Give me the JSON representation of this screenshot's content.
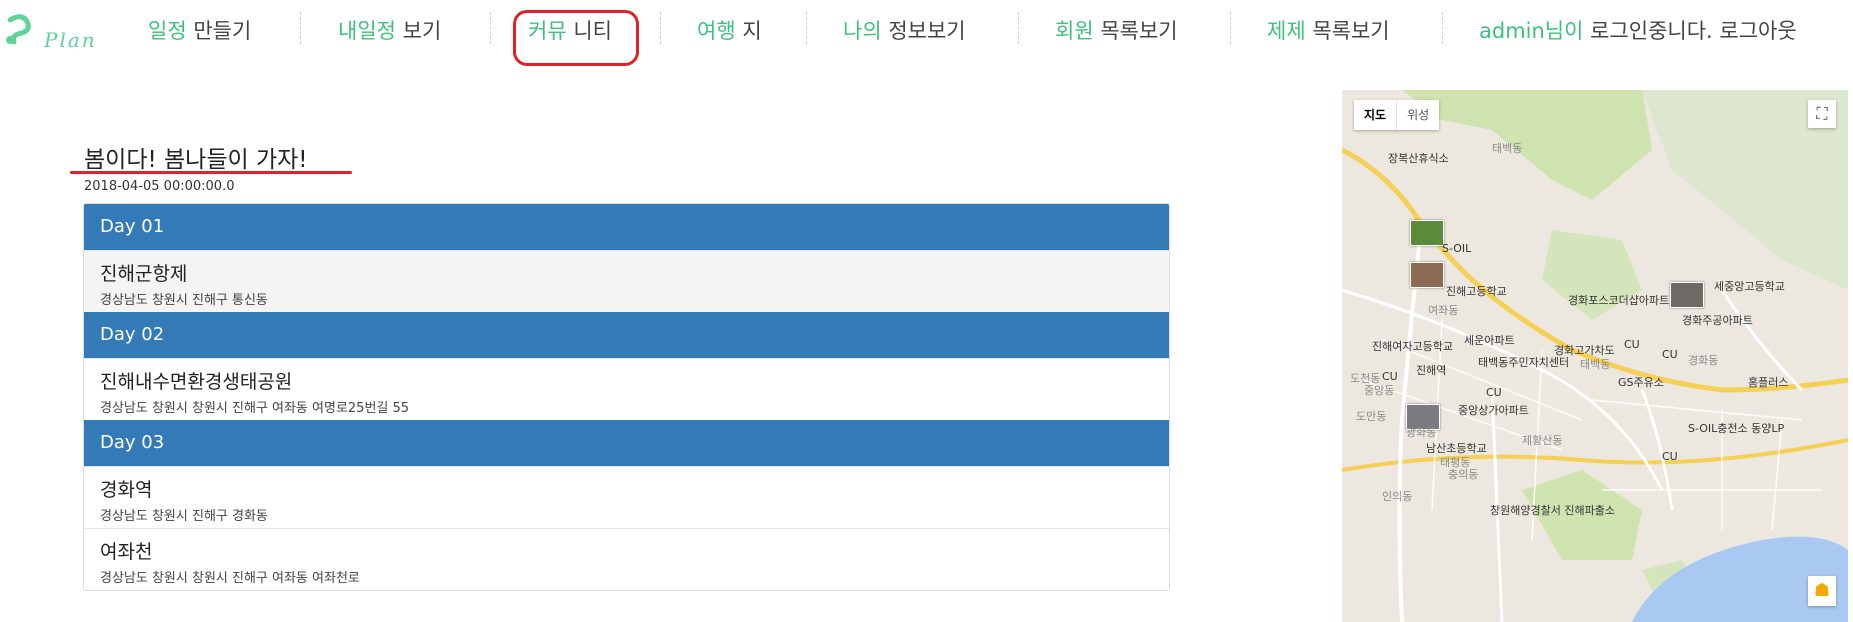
{
  "logo": {
    "text": "Plan"
  },
  "nav": [
    {
      "hl": "일정",
      "rest": " 만들기"
    },
    {
      "hl": "내일정",
      "rest": " 보기"
    },
    {
      "hl": "커뮤",
      "rest": " 니티"
    },
    {
      "hl": "여행",
      "rest": " 지"
    },
    {
      "hl": "나의",
      "rest": " 정보보기"
    },
    {
      "hl": "회원",
      "rest": " 목록보기"
    },
    {
      "hl": "제제",
      "rest": " 목록보기"
    },
    {
      "hl": "admin님이",
      "rest": " 로그인중니다. 로그아웃"
    }
  ],
  "plan": {
    "title": "봄이다! 봄나들이 가자!",
    "date": "2018-04-05 00:00:00.0",
    "days": [
      {
        "label": "Day 01",
        "places": [
          {
            "name": "진해군항제",
            "address": "경상남도 창원시 진해구 통신동"
          }
        ]
      },
      {
        "label": "Day 02",
        "places": [
          {
            "name": "진해내수면환경생태공원",
            "address": "경상남도 창원시 창원시 진해구 여좌동 여명로25번길 55"
          }
        ]
      },
      {
        "label": "Day 03",
        "places": [
          {
            "name": "경화역",
            "address": "경상남도 창원시 진해구 경화동"
          },
          {
            "name": "여좌천",
            "address": "경상남도 창원시 창원시 진해구 여좌동 여좌천로"
          }
        ]
      }
    ]
  },
  "map": {
    "type_map": "지도",
    "type_satellite": "위성",
    "labels": {
      "l1": "장복산휴식소",
      "l2": "태백동",
      "l3": "S-OIL",
      "l4": "진해고등학교",
      "l5": "경화포스코더샵아파트",
      "l6": "세중앙고등학교",
      "l7": "경화주공아파트",
      "l8": "진해여자고등학교",
      "l9": "세운아파트",
      "l10": "경화고가차도",
      "l11": "CU",
      "l12": "태백동주민자치센터",
      "l13": "진해역",
      "l14": "GS주유소",
      "l15": "홈플러스",
      "l16": "CU",
      "l17": "중앙상가아파트",
      "l18": "남산초등학교",
      "l19": "S-OIL충전소 동양LP",
      "l20": "CU",
      "l21": "CU",
      "l22": "창원해양경찰서 진해파출소",
      "l23": "여좌동",
      "l24": "도천동",
      "l25": "중앙동",
      "l26": "광화동",
      "l27": "제황산동",
      "l28": "태평동",
      "l29": "충의동",
      "l30": "인의동",
      "l31": "경화동",
      "l32": "도만동",
      "l33": "CU",
      "l34": "태백동"
    }
  }
}
